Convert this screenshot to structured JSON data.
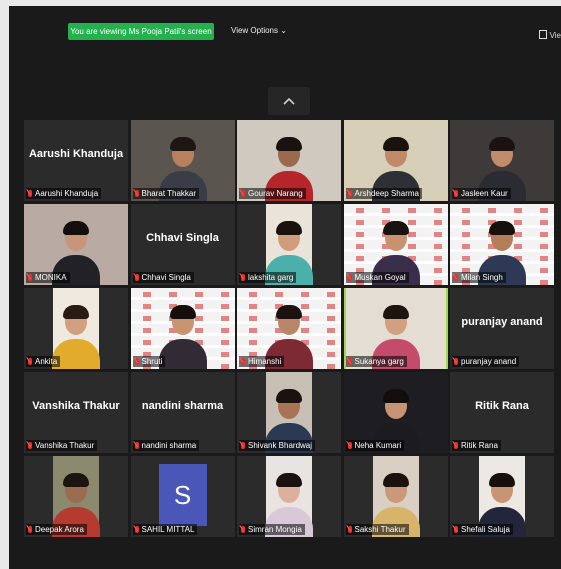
{
  "header": {
    "share_banner": "You are viewing Ms Pooja Patil's screen",
    "view_options": "View Options",
    "view_corner": "Vie"
  },
  "colors": {
    "banner": "#23b14d",
    "active_speaker": "#9bd94b",
    "muted": "#e5312f"
  },
  "participants": [
    {
      "name": "Aarushi Khanduja",
      "center": "Aarushi Khanduja",
      "bg": "#2b2b2b"
    },
    {
      "name": "Bharat Thakkar",
      "center": "",
      "bg": "#5b5550",
      "vw": 104,
      "skin": "#b98060",
      "shirt": "#3a3d45",
      "hair": "#1e1612"
    },
    {
      "name": "Gourav Narang",
      "center": "",
      "bg": "#cfc9bf",
      "vw": 104,
      "skin": "#9a6a4c",
      "shirt": "#b6252a",
      "hair": "#1a120e"
    },
    {
      "name": "Arshdeep Sharma",
      "center": "",
      "bg": "#d8cfb8",
      "vw": 104,
      "skin": "#c08a66",
      "shirt": "#2f3036",
      "hair": "#1a120e"
    },
    {
      "name": "Jasleen Kaur",
      "center": "",
      "bg": "#3f3a3a",
      "vw": 104,
      "skin": "#c28b6b",
      "shirt": "#2b2b33",
      "hair": "#1c1311"
    },
    {
      "name": "MONIKA",
      "center": "",
      "bg": "#b9aaa4",
      "vw": 104,
      "skin": "#c7957a",
      "shirt": "#222226",
      "hair": "#140d0b"
    },
    {
      "name": "Chhavi Singla",
      "center": "Chhavi Singla",
      "bg": "#2b2b2b"
    },
    {
      "name": "lakshita garg",
      "center": "",
      "bg": "#e9e3da",
      "vw": 46,
      "skin": "#d09c7c",
      "shirt": "#4ab0a9",
      "hair": "#1b120f"
    },
    {
      "name": "Muskan Goyal",
      "center": "",
      "bg": "#ffffff",
      "vw": 104,
      "banner": true,
      "skin": "#c89170",
      "shirt": "#3a2f4a",
      "hair": "#1a1210"
    },
    {
      "name": "Milan Singh",
      "center": "",
      "bg": "#ffffff",
      "vw": 104,
      "banner": true,
      "skin": "#b47d5c",
      "shirt": "#2e3a55",
      "hair": "#17100d"
    },
    {
      "name": "Ankita",
      "center": "",
      "bg": "#efe9e0",
      "vw": 46,
      "skin": "#d2a07e",
      "shirt": "#e2ab2c",
      "hair": "#2a1a14"
    },
    {
      "name": "Shruti",
      "center": "",
      "bg": "#ffffff",
      "vw": 104,
      "banner": true,
      "skin": "#c99270",
      "shirt": "#302b35",
      "hair": "#150e0c"
    },
    {
      "name": "Himanshi",
      "center": "",
      "bg": "#ffffff",
      "vw": 104,
      "banner": true,
      "skin": "#b9866a",
      "shirt": "#7d2a34",
      "hair": "#1b120f"
    },
    {
      "name": "Sukanya garg",
      "center": "",
      "bg": "#e3ddd3",
      "vw": 100,
      "skin": "#d3a07f",
      "shirt": "#c44b6b",
      "hair": "#1d1410",
      "active": true
    },
    {
      "name": "puranjay anand",
      "center": "puranjay anand",
      "bg": "#2b2b2b"
    },
    {
      "name": "Vanshika Thakur",
      "center": "Vanshika Thakur",
      "bg": "#2b2b2b"
    },
    {
      "name": "nandini sharma",
      "center": "nandini sharma",
      "bg": "#2b2b2b"
    },
    {
      "name": "Shivank Bhardwaj",
      "center": "",
      "bg": "#c8c0b4",
      "vw": 46,
      "skin": "#a87455",
      "shirt": "#2a3a53",
      "hair": "#1a120e"
    },
    {
      "name": "Neha Kumari",
      "center": "",
      "bg": "#1e1e22",
      "vw": 104,
      "skin": "#c79473",
      "shirt": "#1b1b20",
      "hair": "#140d0b"
    },
    {
      "name": "Ritik Rana",
      "center": "Ritik Rana",
      "bg": "#2b2b2b"
    },
    {
      "name": "Deepak Arora",
      "center": "",
      "bg": "#8c8a6e",
      "vw": 46,
      "skin": "#9c6c4e",
      "shirt": "#b53a2f",
      "hair": "#1b1410"
    },
    {
      "name": "SAHIL MITTAL",
      "center": "",
      "bg": "#2b2b2b",
      "avatar": "S"
    },
    {
      "name": "Simran Mongia",
      "center": "",
      "bg": "#e8e4e2",
      "vw": 46,
      "skin": "#dcb09a",
      "shirt": "#d9c8d8",
      "hair": "#1a1210"
    },
    {
      "name": "Sakshi Thakur",
      "center": "",
      "bg": "#d9cfc2",
      "vw": 46,
      "skin": "#cc987a",
      "shirt": "#d8b46a",
      "hair": "#1b120f"
    },
    {
      "name": "Shefali Saluja",
      "center": "",
      "bg": "#ece8e3",
      "vw": 46,
      "skin": "#c99474",
      "shirt": "#23263a",
      "hair": "#160f0c"
    }
  ]
}
